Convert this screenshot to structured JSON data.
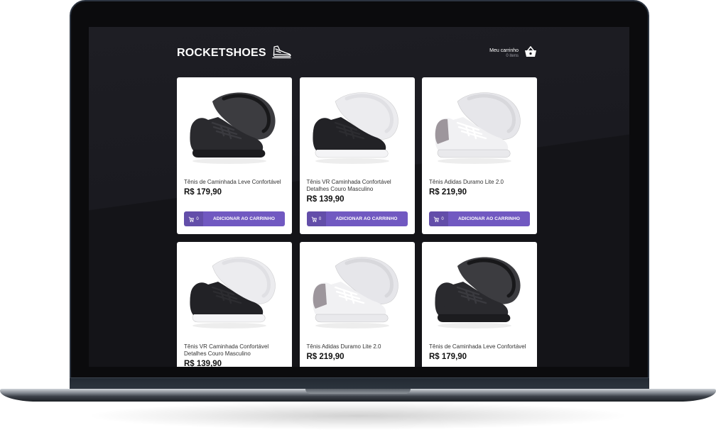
{
  "header": {
    "logo": "ROCKETSHOES",
    "cart": {
      "title": "Meu carrinho",
      "count": "0 itens"
    }
  },
  "colors": {
    "accent": "#7159c1",
    "background": "#191920",
    "card": "#ffffff"
  },
  "products": [
    {
      "title": "Tênis de Caminhada Leve Confortável",
      "price": "R$ 179,90",
      "qty": "0",
      "button": "ADICIONAR AO CARRINHO",
      "shoe": "black"
    },
    {
      "title": "Tênis VR Caminhada Confortável Detalhes Couro Masculino",
      "price": "R$ 139,90",
      "qty": "0",
      "button": "ADICIONAR AO CARRINHO",
      "shoe": "black-white"
    },
    {
      "title": "Tênis Adidas Duramo Lite 2.0",
      "price": "R$ 219,90",
      "qty": "0",
      "button": "ADICIONAR AO CARRINHO",
      "shoe": "white-grey"
    },
    {
      "title": "Tênis VR Caminhada Confortável Detalhes Couro Masculino",
      "price": "R$ 139,90",
      "shoe": "black-white"
    },
    {
      "title": "Tênis Adidas Duramo Lite 2.0",
      "price": "R$ 219,90",
      "shoe": "white-grey"
    },
    {
      "title": "Tênis de Caminhada Leve Confortável",
      "price": "R$ 179,90",
      "shoe": "black"
    }
  ],
  "icons": {
    "logo": "shoe-icon",
    "cart": "shopping-basket-icon",
    "add": "add-to-cart-icon"
  }
}
